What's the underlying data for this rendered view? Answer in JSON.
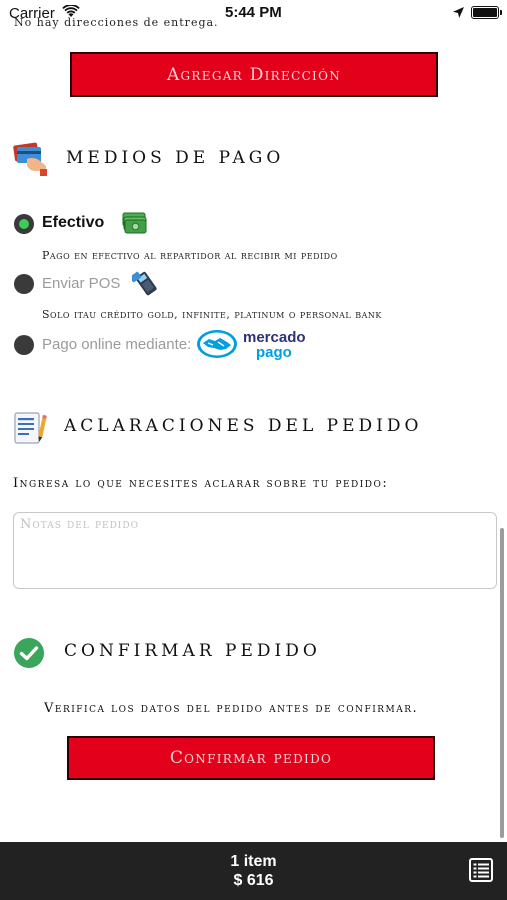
{
  "status_bar": {
    "carrier": "Carrier",
    "time": "5:44 PM"
  },
  "address": {
    "empty_text": "No hay direcciones de entrega.",
    "add_button": "Agregar Dirección"
  },
  "payment": {
    "title": "MEDIOS DE PAGO",
    "options": [
      {
        "label": "Efectivo",
        "selected": true,
        "description": "Pago en efectivo al repartidor al recibir mi pedido",
        "icon": "cash-icon"
      },
      {
        "label": "Enviar POS",
        "selected": false,
        "description": "Solo itau crédito gold, infinite, platinum o personal bank",
        "icon": "pos-terminal-icon"
      },
      {
        "label": "Pago online mediante:",
        "selected": false,
        "icon": "mercado-pago-logo",
        "logo_text": [
          "mercado",
          "pago"
        ]
      }
    ]
  },
  "notes": {
    "title": "ACLARACIONES DEL PEDIDO",
    "hint": "Ingresa lo que necesites aclarar sobre tu pedido:",
    "placeholder": "Notas del pedido",
    "value": ""
  },
  "confirm": {
    "title": "CONFIRMAR PEDIDO",
    "hint": "Verifica los datos del pedido antes de confirmar.",
    "button": "Confirmar pedido"
  },
  "cart": {
    "items": "1 item",
    "total": "$ 616"
  },
  "colors": {
    "primary_red": "#e3001b",
    "selected_green": "#3ccb55",
    "footer_bg": "#222222"
  }
}
